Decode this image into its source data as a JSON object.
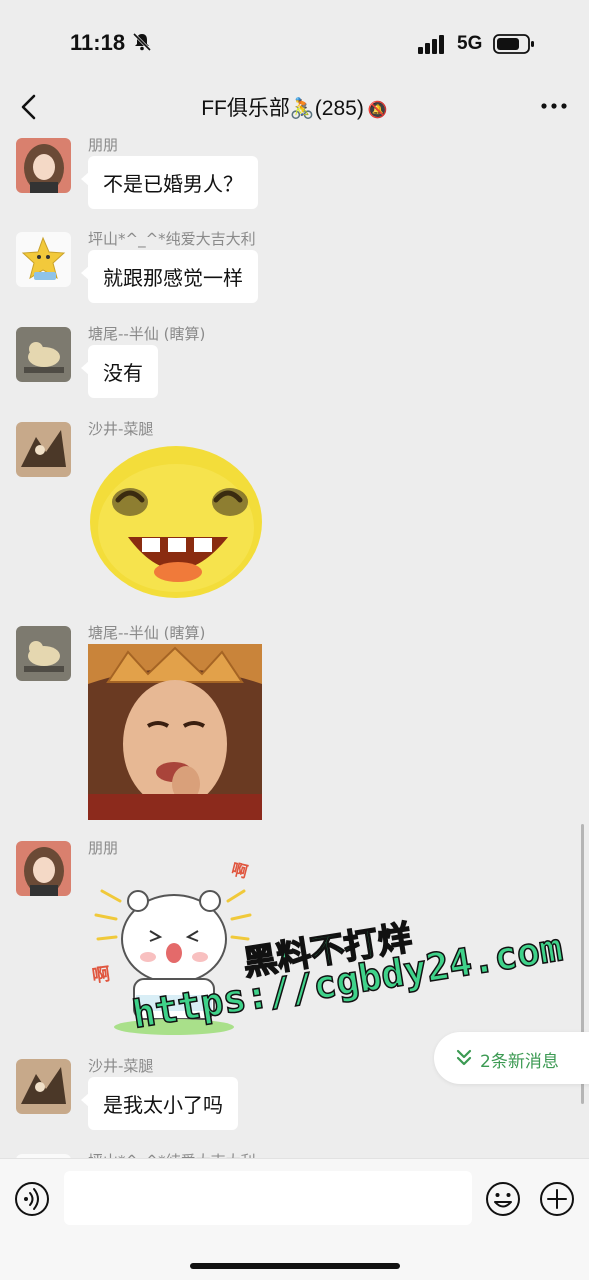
{
  "status_bar": {
    "time": "11:18",
    "network": "5G"
  },
  "nav": {
    "title": "FF俱乐部",
    "title_emoji": "🚴",
    "member_count": "(285)"
  },
  "messages": [
    {
      "sender": "朋朋",
      "text": "不是已婚男人？"
    },
    {
      "sender": "坪山*^_^*纯爱大吉大利",
      "text": "就跟那感觉一样"
    },
    {
      "sender": "塘尾--半仙 (瞎算)",
      "text": "没有"
    },
    {
      "sender": "沙井-菜腿",
      "sticker": "laughing-emoji-sticker"
    },
    {
      "sender": "塘尾--半仙 (瞎算)",
      "sticker": "monk-laughing-sticker"
    },
    {
      "sender": "朋朋",
      "sticker": "bear-sticker",
      "sticker_text": "啊"
    },
    {
      "sender": "沙井-菜腿",
      "text": "是我太小了吗"
    },
    {
      "sender": "坪山*^_^*纯爱大吉大利"
    }
  ],
  "new_messages_pill": {
    "label": "2条新消息"
  },
  "watermark": {
    "line1": "黑料不打烊",
    "line2": "https://cgbdy24.com"
  },
  "colors": {
    "background": "#ededed",
    "accent_green": "#3c9a53",
    "watermark_green": "#3fd28a"
  }
}
